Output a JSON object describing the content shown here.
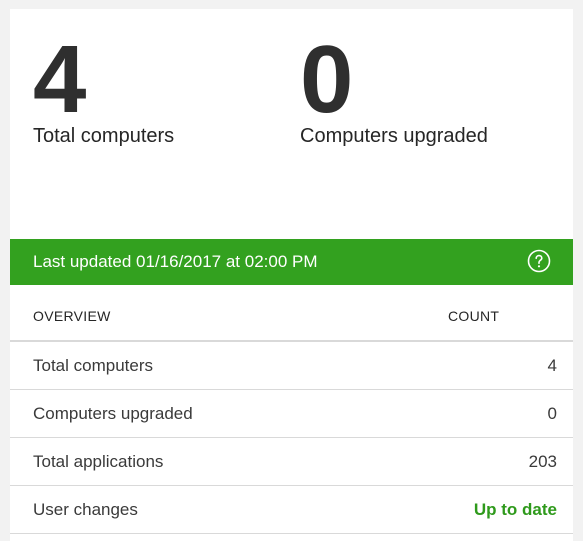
{
  "stats": [
    {
      "value": "4",
      "label": "Total computers"
    },
    {
      "value": "0",
      "label": "Computers upgraded"
    }
  ],
  "banner": {
    "text": "Last updated 01/16/2017 at 02:00 PM",
    "icon": "help-circle-icon",
    "color": "#33a11f"
  },
  "table": {
    "headers": {
      "overview": "OVERVIEW",
      "count": "COUNT"
    },
    "rows": [
      {
        "label": "Total computers",
        "value": "4"
      },
      {
        "label": "Computers upgraded",
        "value": "0"
      },
      {
        "label": "Total applications",
        "value": "203"
      },
      {
        "label": "User changes",
        "value": "Up to date",
        "status_color": "#2f9a1c"
      }
    ]
  }
}
